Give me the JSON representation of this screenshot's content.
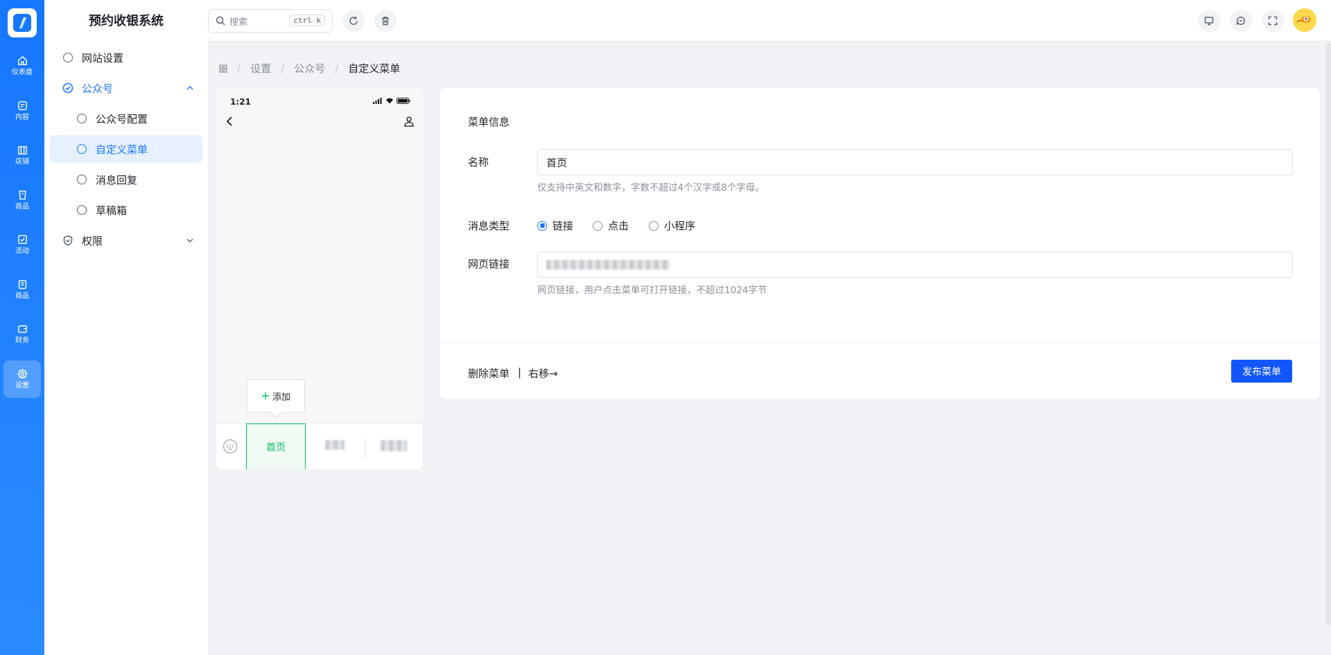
{
  "app": {
    "title": "预约收银系统"
  },
  "rail": [
    {
      "label": "仪表盘",
      "icon": "home-icon"
    },
    {
      "label": "内容",
      "icon": "content-icon"
    },
    {
      "label": "店铺",
      "icon": "store-icon"
    },
    {
      "label": "商品",
      "icon": "product-icon"
    },
    {
      "label": "活动",
      "icon": "activity-icon"
    },
    {
      "label": "商品",
      "icon": "goods-icon"
    },
    {
      "label": "财务",
      "icon": "wallet-icon"
    },
    {
      "label": "设置",
      "icon": "settings-icon"
    }
  ],
  "sidebar": {
    "items": [
      {
        "label": "网站设置"
      },
      {
        "label": "公众号"
      },
      {
        "label": "公众号配置"
      },
      {
        "label": "自定义菜单"
      },
      {
        "label": "消息回复"
      },
      {
        "label": "草稿箱"
      },
      {
        "label": "权限"
      }
    ]
  },
  "topbar": {
    "search_placeholder": "搜索",
    "search_shortcut": "ctrl k"
  },
  "breadcrumb": {
    "items": [
      "设置",
      "公众号",
      "自定义菜单"
    ]
  },
  "phone": {
    "time": "1:21",
    "add_label": "添加",
    "tabs": [
      {
        "label": "首页"
      }
    ]
  },
  "editor": {
    "title": "菜单信息",
    "name_label": "名称",
    "name_value": "首页",
    "name_hint": "仅支持中英文和数字，字数不超过4个汉字或8个字母。",
    "type_label": "消息类型",
    "types": [
      "链接",
      "点击",
      "小程序"
    ],
    "selected_type": "链接",
    "url_label": "网页链接",
    "url_hint": "网页链接，用户点击菜单可打开链接，不超过1024字节",
    "delete_label": "删除菜单",
    "divider": "|",
    "move_label": "右移→",
    "publish_label": "发布菜单"
  },
  "colors": {
    "primary": "#1677ff",
    "rail_bg": "#1677ff",
    "wechat_green": "#07c160",
    "publish": "#1256ff"
  }
}
